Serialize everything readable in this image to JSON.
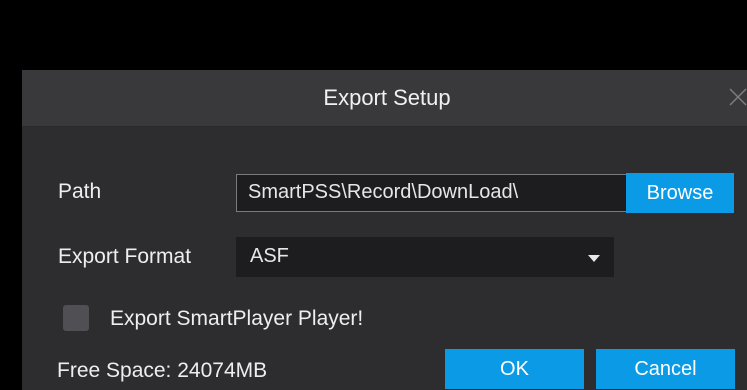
{
  "dialog": {
    "title": "Export Setup",
    "close_icon": "close-icon"
  },
  "path": {
    "label": "Path",
    "value": "SmartPSS\\Record\\DownLoad\\",
    "browse_label": "Browse"
  },
  "export_format": {
    "label": "Export Format",
    "selected": "ASF"
  },
  "smartplayer_option": {
    "label": "Export SmartPlayer Player!",
    "checked": false
  },
  "free_space": {
    "text": "Free Space:  24074MB"
  },
  "buttons": {
    "ok_label": "OK",
    "cancel_label": "Cancel"
  },
  "colors": {
    "accent": "#0b9be6",
    "dialog_background": "#2d2d2f",
    "title_background": "#39393c",
    "field_background": "#1d1d1f"
  }
}
